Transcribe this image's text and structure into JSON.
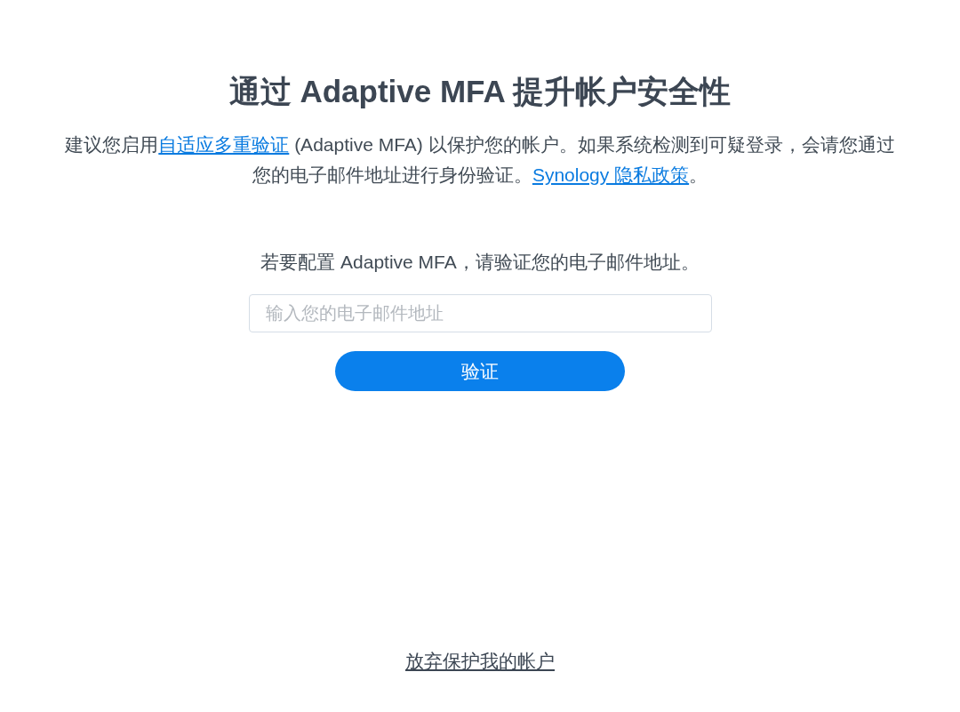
{
  "title": "通过 Adaptive MFA 提升帐户安全性",
  "intro": {
    "parts": [
      {
        "kind": "text",
        "text": "建议您启用"
      },
      {
        "kind": "link",
        "text": "自适应多重验证"
      },
      {
        "kind": "text",
        "text": " (Adaptive MFA) 以保护您的帐户。如果系统检测到可疑登录，会请您通过您的电子邮件地址进行身份验证。"
      },
      {
        "kind": "link",
        "text": "Synology 隐私政策"
      },
      {
        "kind": "text",
        "text": "。"
      }
    ]
  },
  "prompt": "若要配置 Adaptive MFA，请验证您的电子邮件地址。",
  "email_field": {
    "placeholder": "输入您的电子邮件地址"
  },
  "verify_button": "验证",
  "skip_link": "放弃保护我的帐户"
}
